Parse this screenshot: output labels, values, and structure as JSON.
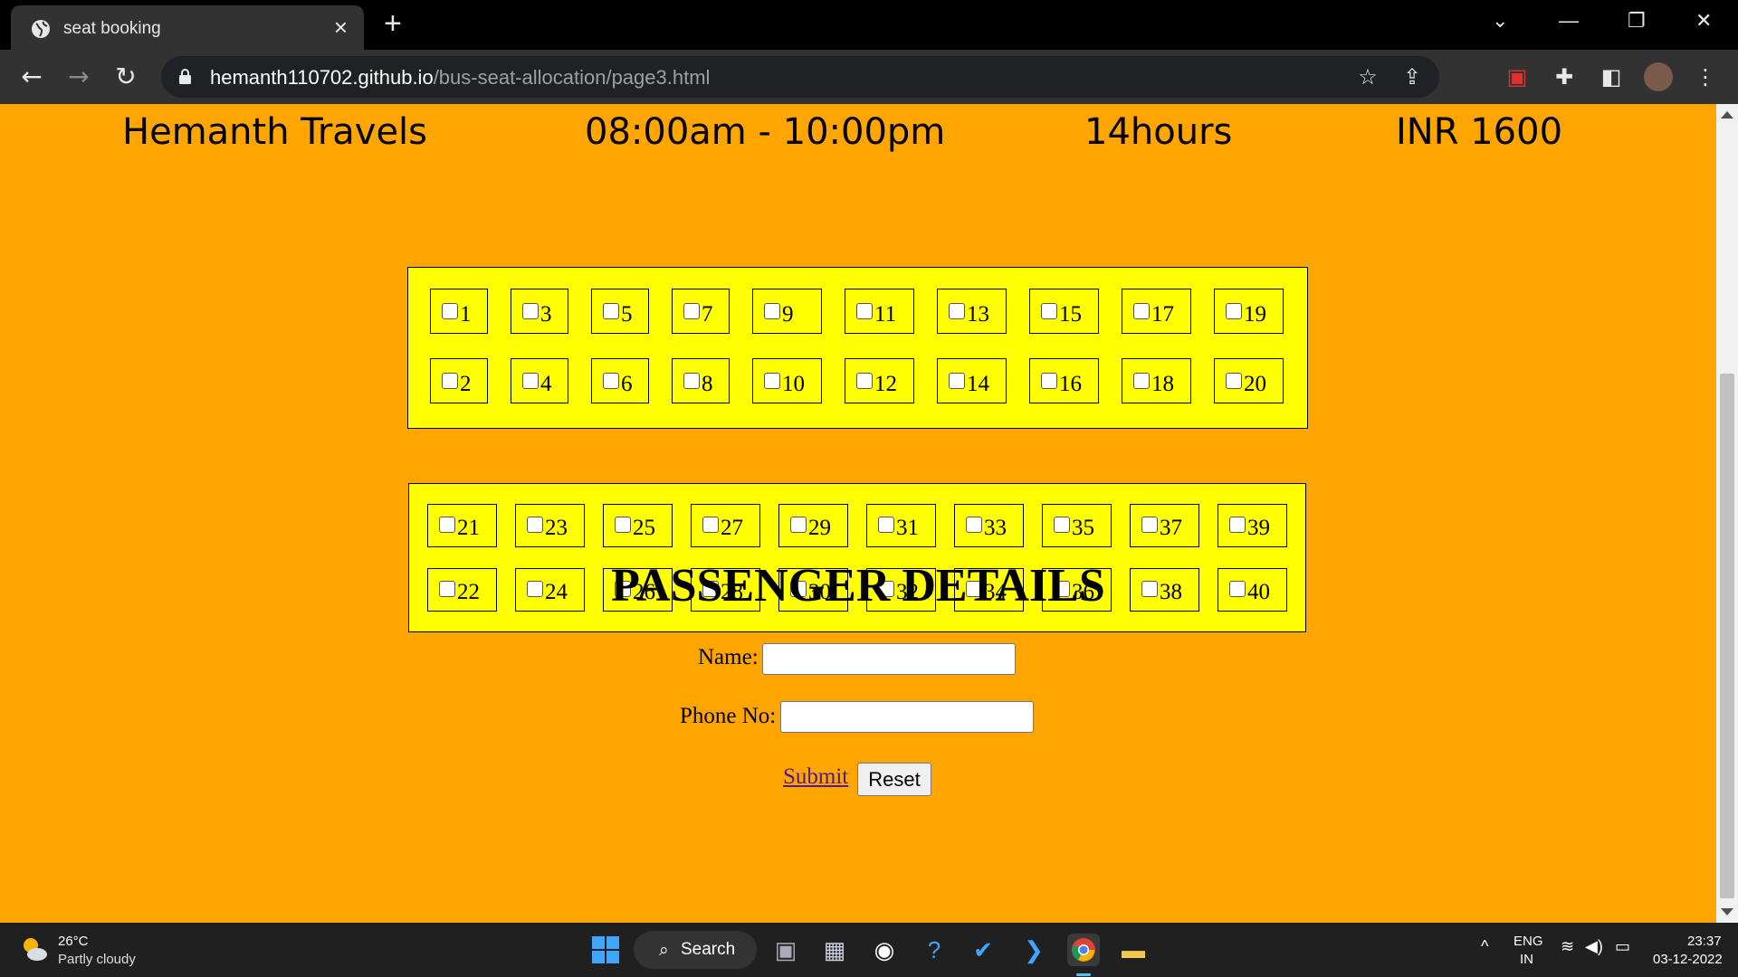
{
  "browser": {
    "tab_title": "seat booking",
    "url_host": "hemanth110702.github.io",
    "url_path": "/bus-seat-allocation/page3.html"
  },
  "header": {
    "operator": "Hemanth Travels",
    "timing": "08:00am - 10:00pm",
    "duration": "14hours",
    "fare": "INR 1600"
  },
  "deck1": {
    "row1": [
      "1",
      "3",
      "5",
      "7",
      "9",
      "11",
      "13",
      "15",
      "17",
      "19"
    ],
    "row2": [
      "2",
      "4",
      "6",
      "8",
      "10",
      "12",
      "14",
      "16",
      "18",
      "20"
    ]
  },
  "deck2": {
    "row1": [
      "21",
      "23",
      "25",
      "27",
      "29",
      "31",
      "33",
      "35",
      "37",
      "39"
    ],
    "row2": [
      "22",
      "24",
      "26",
      "28",
      "30",
      "32",
      "34",
      "36",
      "38",
      "40"
    ]
  },
  "form": {
    "title": "PASSENGER DETAILS",
    "name_label": "Name:",
    "name_value": "",
    "phone_label": "Phone No:",
    "phone_value": "",
    "submit_label": "Submit",
    "reset_label": "Reset"
  },
  "taskbar": {
    "weather_temp": "26°C",
    "weather_desc": "Partly cloudy",
    "search_label": "Search",
    "lang_top": "ENG",
    "lang_bottom": "IN",
    "time": "23:37",
    "date": "03-12-2022"
  },
  "colors": {
    "page_bg": "#ffa500",
    "deck_bg": "#ffff00"
  }
}
